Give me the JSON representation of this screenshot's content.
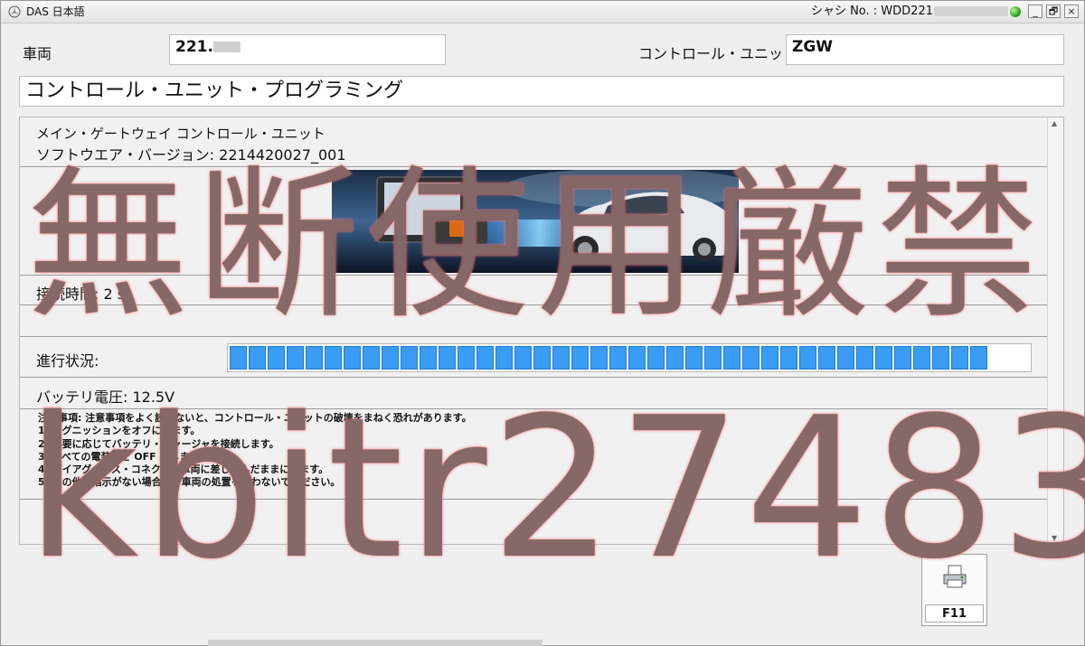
{
  "titlebar": {
    "app_title": "DAS 日本語",
    "chassis_label": "シャシ No. : WDD221",
    "status_color": "#2fa81a",
    "buttons": [
      "_",
      "🗗",
      "×"
    ]
  },
  "vehicle": {
    "label": "車両",
    "value": "221."
  },
  "control_unit": {
    "label": "コントロール・ユニット",
    "value": "ZGW"
  },
  "heading": "コントロール・ユニット・プログラミング",
  "unit_info": {
    "name": "メイン・ゲートウェイ コントロール・ユニット",
    "software_version": "ソフトウエア・バージョン: 2214420027_001"
  },
  "connection_time": "接続時間: 2 s",
  "progress": {
    "label": "進行状況:",
    "value": 0.945,
    "color": "#3a9cf2"
  },
  "battery": "バッテリ電圧: 12.5V",
  "notes": [
    "注意事項: 注意事項をよく読まないと、コントロール・ユニットの破壊をまねく恐れがあります。",
    "1. イグニッションをオフにします。",
    "2. 必要に応じてバッテリ・チャージャを接続します。",
    "3. すべての電装品を OFF にします。",
    "4. ダイアグノシス・コネクタは車両に差し込んだままにします。",
    "5. その他の指示がない場合は、車両の処置を行わないでください。"
  ],
  "print_button": {
    "key": "F11",
    "icon": "printer-icon"
  },
  "watermark": {
    "line1": "無断使用厳禁",
    "line2": "kbitr27483"
  }
}
